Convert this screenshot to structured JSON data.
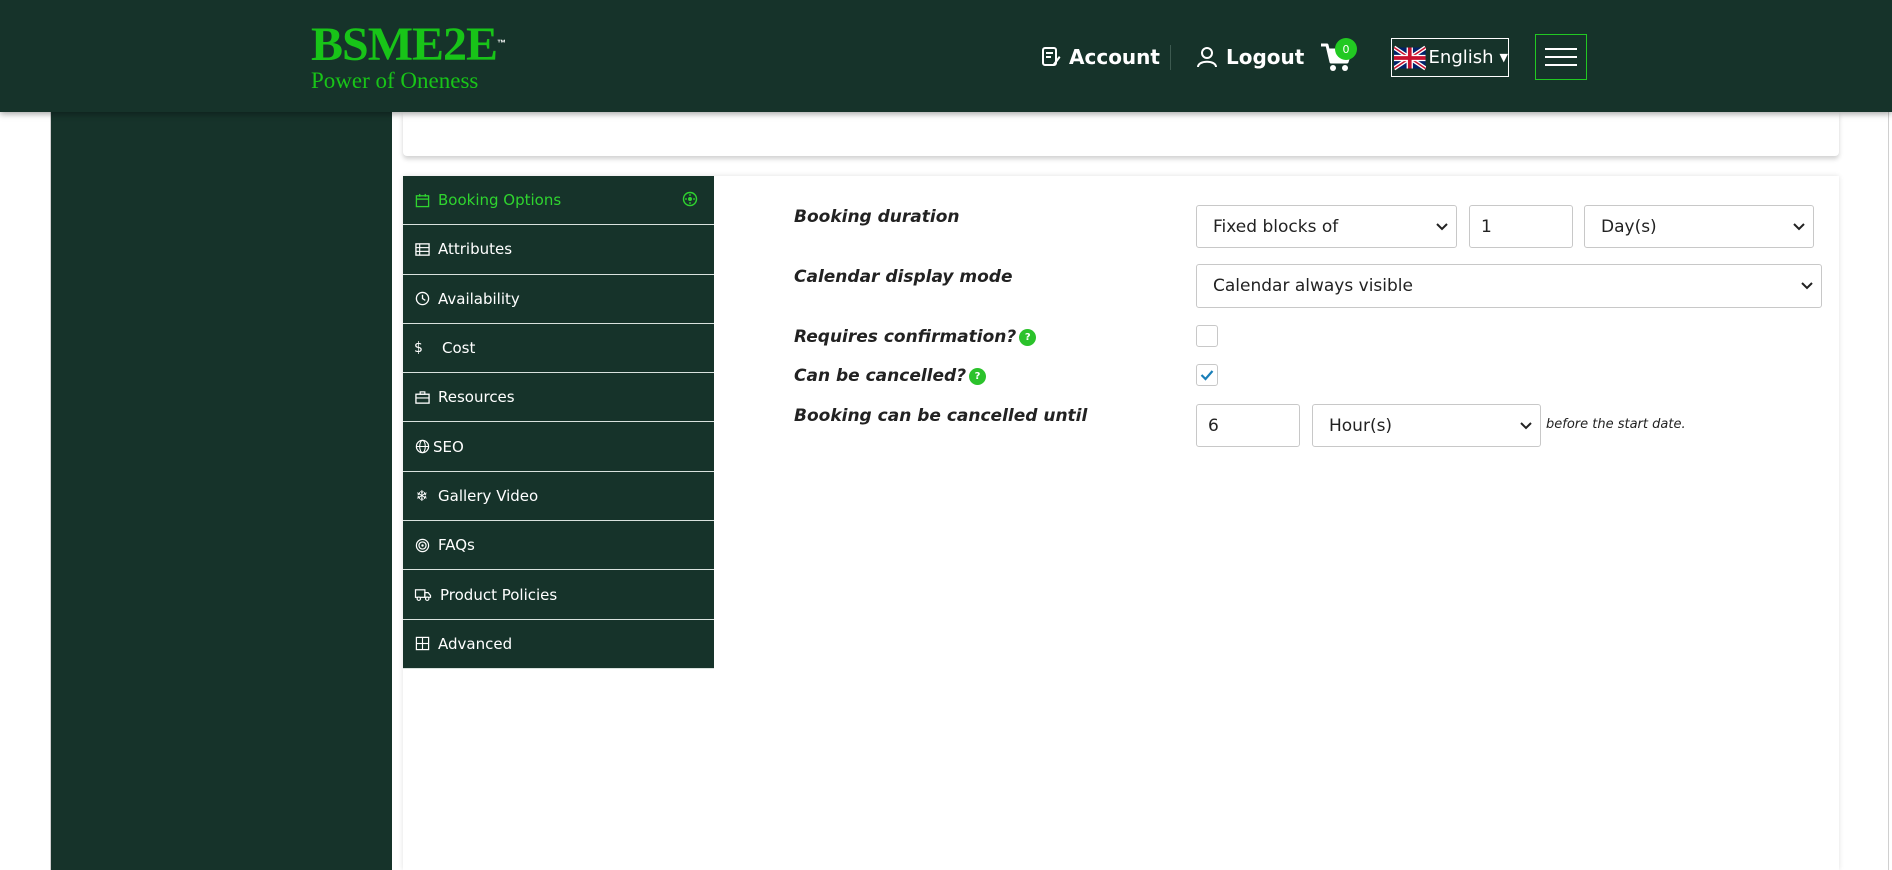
{
  "brand": {
    "name": "BSME2E",
    "tm": "™",
    "tagline": "Power of Oneness"
  },
  "header": {
    "account_label": "Account",
    "logout_label": "Logout",
    "cart_count": "0",
    "language": "English"
  },
  "tabs": [
    {
      "label": "Booking Options",
      "icon": "calendar-icon",
      "active": true
    },
    {
      "label": "Attributes",
      "icon": "list-icon"
    },
    {
      "label": "Availability",
      "icon": "clock-icon"
    },
    {
      "label": "Cost",
      "icon": "dollar-icon"
    },
    {
      "label": "Resources",
      "icon": "briefcase-icon"
    },
    {
      "label": "SEO",
      "icon": "globe-icon"
    },
    {
      "label": "Gallery Video",
      "icon": "snowflake-icon"
    },
    {
      "label": "FAQs",
      "icon": "target-icon"
    },
    {
      "label": "Product Policies",
      "icon": "truck-icon"
    },
    {
      "label": "Advanced",
      "icon": "grid-icon"
    }
  ],
  "form": {
    "booking_duration": {
      "label": "Booking duration",
      "type_value": "Fixed blocks of",
      "amount_value": "1",
      "unit_value": "Day(s)"
    },
    "calendar_display": {
      "label": "Calendar display mode",
      "value": "Calendar always visible"
    },
    "requires_confirmation": {
      "label": "Requires confirmation?",
      "checked": false
    },
    "can_be_cancelled": {
      "label": "Can be cancelled?",
      "checked": true
    },
    "cancel_until": {
      "label": "Booking can be cancelled until",
      "amount_value": "6",
      "unit_value": "Hour(s)",
      "suffix": "before the start date."
    }
  },
  "colors": {
    "header_bg": "#16332a",
    "accent_green": "#22c922",
    "check_color": "#1a7fb8"
  }
}
